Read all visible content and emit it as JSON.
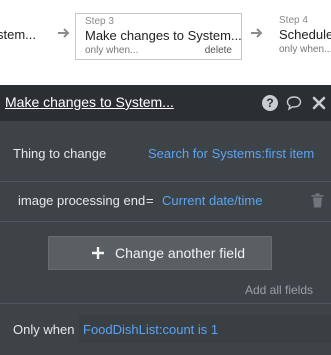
{
  "workflow": {
    "prev_step": {
      "label": "stem..."
    },
    "current_step": {
      "number": "Step 3",
      "title": "Make changes to System...",
      "condition": "only when...",
      "delete": "delete"
    },
    "next_step": {
      "number": "Step 4",
      "title": "Schedule",
      "condition": "only when..."
    }
  },
  "panel": {
    "title": "Make changes to System...",
    "icons": [
      "help-icon",
      "comment-icon",
      "close-icon"
    ],
    "thing_to_change": {
      "label": "Thing to change",
      "value": "Search for Systems:first item"
    },
    "field": {
      "name": "image processing end",
      "operator": "=",
      "value": "Current date/time"
    },
    "change_field_button": "Change another field",
    "add_all_fields": "Add all fields",
    "only_when": {
      "label": "Only when",
      "value": "FoodDishList:count is 1"
    }
  },
  "colors": {
    "panel_bg": "#3e4348",
    "header_bg": "#2b2f34",
    "link": "#5aa4f5"
  }
}
